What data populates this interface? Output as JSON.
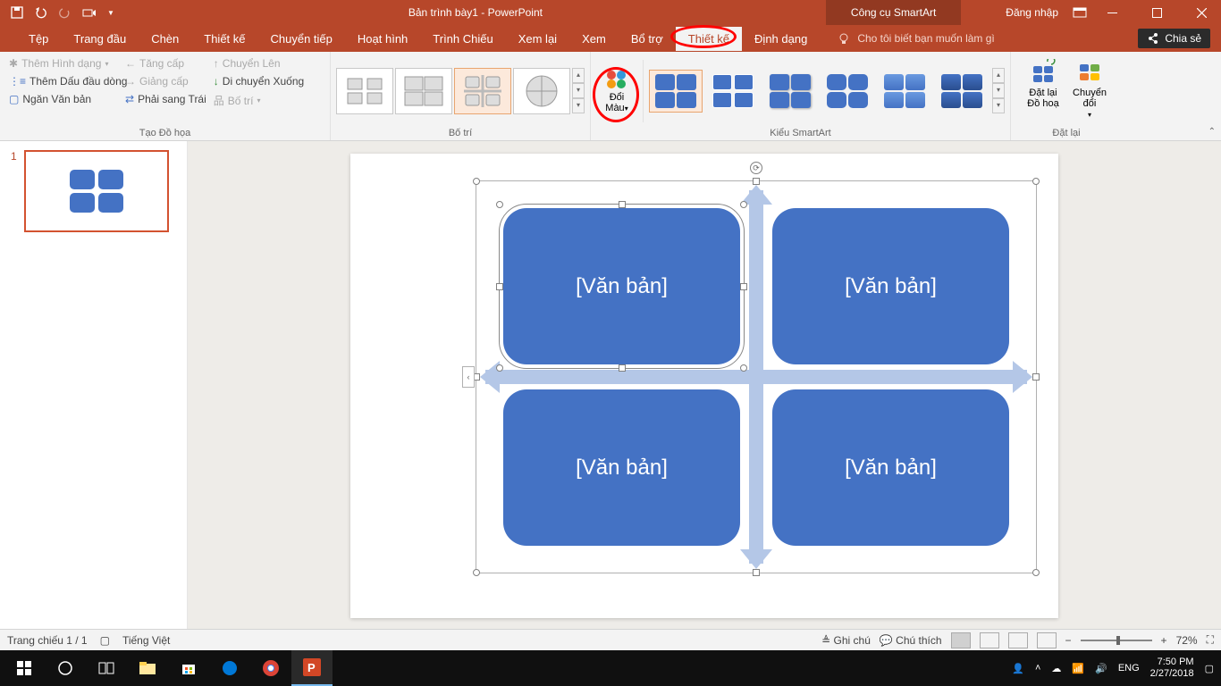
{
  "title": {
    "doc": "Bản trình bày1",
    "sep": " - ",
    "app": "PowerPoint",
    "context": "Công cụ SmartArt",
    "signin": "Đăng nhập"
  },
  "tabs": [
    "Tệp",
    "Trang đầu",
    "Chèn",
    "Thiết kế",
    "Chuyển tiếp",
    "Hoạt hình",
    "Trình Chiếu",
    "Xem lại",
    "Xem",
    "Bổ trợ",
    "Thiết kế",
    "Định dạng"
  ],
  "active_tab_index": 10,
  "tellme": "Cho tôi biết bạn muốn làm gì",
  "share": "Chia sẻ",
  "create_graphic": {
    "add_shape": "Thêm Hình dạng",
    "add_bullet": "Thêm Dấu đầu dòng",
    "text_pane": "Ngăn Văn bản",
    "promote": "Tăng cấp",
    "demote": "Giảng cấp",
    "rtl": "Phải sang Trái",
    "move_up": "Chuyển Lên",
    "move_down": "Di chuyển Xuống",
    "layout": "Bố trí",
    "group_label": "Tạo Đồ họa"
  },
  "layouts_label": "Bố trí",
  "change_colors": {
    "line1": "Đổi",
    "line2": "Màu"
  },
  "styles_label": "Kiểu SmartArt",
  "reset": {
    "reset_graphic": "Đặt lại\nĐồ hoạ",
    "convert": "Chuyển\nđổi",
    "group_label": "Đặt lại"
  },
  "slide_num": "1",
  "placeholder": "[Văn bản]",
  "status": {
    "slide": "Trang chiếu 1 / 1",
    "lang": "Tiếng Việt",
    "notes": "Ghi chú",
    "comments": "Chú thích",
    "zoom": "72%"
  },
  "taskbar": {
    "lang": "ENG",
    "time": "7:50 PM",
    "date": "2/27/2018"
  }
}
